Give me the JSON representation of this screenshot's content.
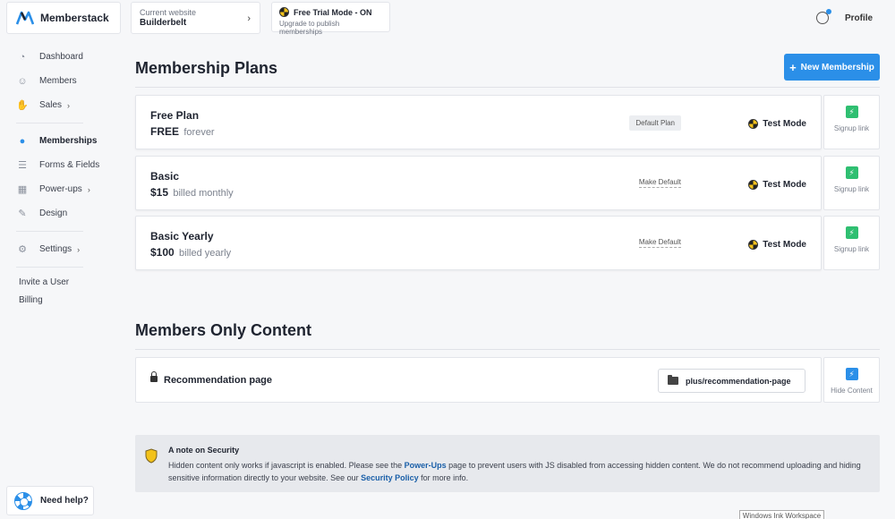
{
  "brand": {
    "name": "Memberstack"
  },
  "site": {
    "caption": "Current website",
    "name": "Builderbelt"
  },
  "trial": {
    "title": "Free Trial Mode - ON",
    "subtitle": "Upgrade to publish memberships"
  },
  "profile": {
    "label": "Profile"
  },
  "nav": {
    "items": [
      {
        "label": "Dashboard",
        "icon": "dashboard-icon"
      },
      {
        "label": "Members",
        "icon": "user-icon"
      },
      {
        "label": "Sales",
        "icon": "hand-icon"
      },
      {
        "label": "Memberships",
        "icon": "membership-icon"
      },
      {
        "label": "Forms & Fields",
        "icon": "list-icon"
      },
      {
        "label": "Power-ups",
        "icon": "blocks-icon"
      },
      {
        "label": "Design",
        "icon": "pen-icon"
      },
      {
        "label": "Settings",
        "icon": "gear-icon"
      }
    ],
    "invite": "Invite a User",
    "billing": "Billing"
  },
  "help": {
    "label": "Need help?"
  },
  "plans": {
    "title": "Membership Plans",
    "new_button": "New Membership",
    "mode_label": "Test Mode",
    "signup_label": "Signup link",
    "items": [
      {
        "name": "Free Plan",
        "price": "FREE",
        "period": "forever",
        "tag": "Default Plan"
      },
      {
        "name": "Basic",
        "price": "$15",
        "period": "billed monthly",
        "tag": "Make Default"
      },
      {
        "name": "Basic Yearly",
        "price": "$100",
        "period": "billed yearly",
        "tag": "Make Default"
      }
    ]
  },
  "content": {
    "title": "Members Only Content",
    "item_name": "Recommendation page",
    "path": "plus/recommendation-page",
    "hide_label": "Hide Content"
  },
  "note": {
    "title": "A note on Security",
    "body_1": "Hidden content only works if javascript is enabled. Please see the ",
    "link_1": "Power-Ups",
    "body_2": " page to prevent users with JS disabled from accessing hidden content.  We do not recommend uploading and hiding sensitive information directly to your website. See our ",
    "link_2": "Security Policy",
    "body_3": " for more info."
  },
  "overlay": {
    "label": "Windows Ink Workspace"
  },
  "colors": {
    "accent": "#2b8fe8",
    "signup_green": "#2fbf71",
    "link": "#1a5fa8"
  }
}
